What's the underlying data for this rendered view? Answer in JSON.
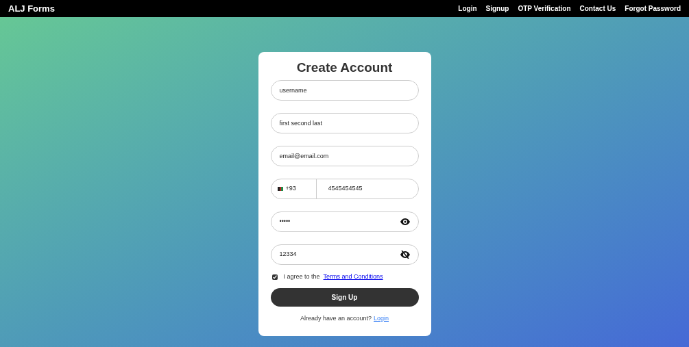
{
  "navbar": {
    "brand": "ALJ Forms",
    "links": [
      "Login",
      "Signup",
      "OTP Verification",
      "Contact Us",
      "Forgot Password"
    ]
  },
  "form": {
    "title": "Create Account",
    "fields": [
      {
        "kind": "text",
        "value": "username"
      },
      {
        "kind": "text",
        "value": "first second last"
      },
      {
        "kind": "text",
        "value": "email@email.com"
      },
      {
        "kind": "phone",
        "code": "+93",
        "value": "4545454545"
      },
      {
        "kind": "password",
        "value": "•••••",
        "revealed": false
      },
      {
        "kind": "password",
        "value": "12334",
        "revealed": true
      }
    ],
    "terms": {
      "checked": true,
      "text": "I agree to the",
      "link": "Terms and Conditions"
    },
    "submit": "Sign Up",
    "footer": {
      "text": "Already have an account?",
      "link": "Login"
    }
  }
}
